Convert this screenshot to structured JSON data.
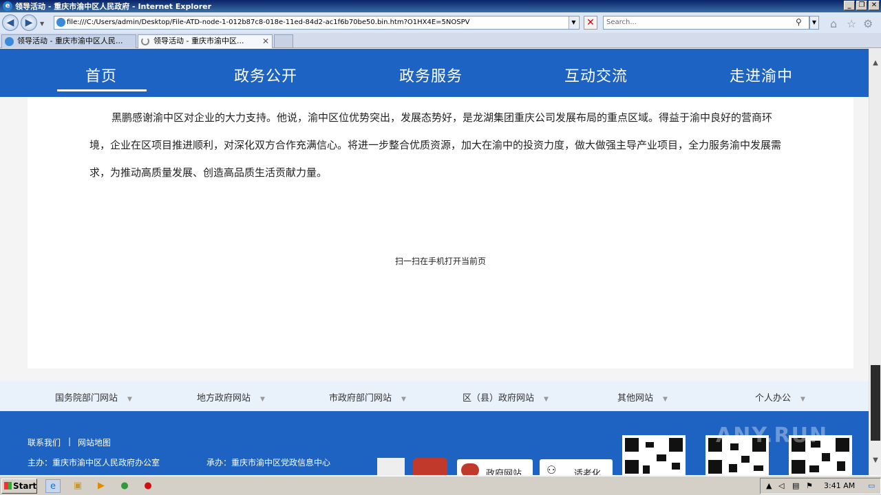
{
  "window": {
    "title": "领导活动 - 重庆市渝中区人民政府 - Internet Explorer",
    "minimize": "_",
    "restore": "❐",
    "close": "✕"
  },
  "browser": {
    "address": "file:///C:/Users/admin/Desktop/File-ATD-node-1-012b87c8-018e-11ed-84d2-ac1f6b70be50.bin.htm?O1HX4E=5NOSPV",
    "search_placeholder": "Search...",
    "tabs": [
      {
        "label": "领导活动 - 重庆市渝中区人民..."
      },
      {
        "label": "领导活动 - 重庆市渝中区..."
      }
    ]
  },
  "nav": {
    "items": [
      "首页",
      "政务公开",
      "政务服务",
      "互动交流",
      "走进渝中"
    ]
  },
  "article": {
    "paragraph": "黑鹏感谢渝中区对企业的大力支持。他说，渝中区位优势突出，发展态势好，是龙湖集团重庆公司发展布局的重点区域。得益于渝中良好的营商环境，企业在区项目推进顺利，对深化双方合作充满信心。将进一步整合优质资源，加大在渝中的投资力度，做大做强主导产业项目，全力服务渝中发展需求，为推动高质量发展、创造高品质生活贡献力量。",
    "qr_note": "扫一扫在手机打开当前页"
  },
  "links_bar": {
    "items": [
      "国务院部门网站",
      "地方政府网站",
      "市政府部门网站",
      "区（县）政府网站",
      "其他网站",
      "个人办公"
    ]
  },
  "footer": {
    "contact": "联系我们",
    "sep": "|",
    "sitemap": "网站地图",
    "host": "主办：重庆市渝中区人民政府办公室",
    "organizer": "承办：重庆市渝中区党政信息中心",
    "badge_gov": "政府网站",
    "badge_elder": "适老化",
    "watermark": "ANY.RUN"
  },
  "taskbar": {
    "start": "Start",
    "time": "3:41 AM"
  }
}
